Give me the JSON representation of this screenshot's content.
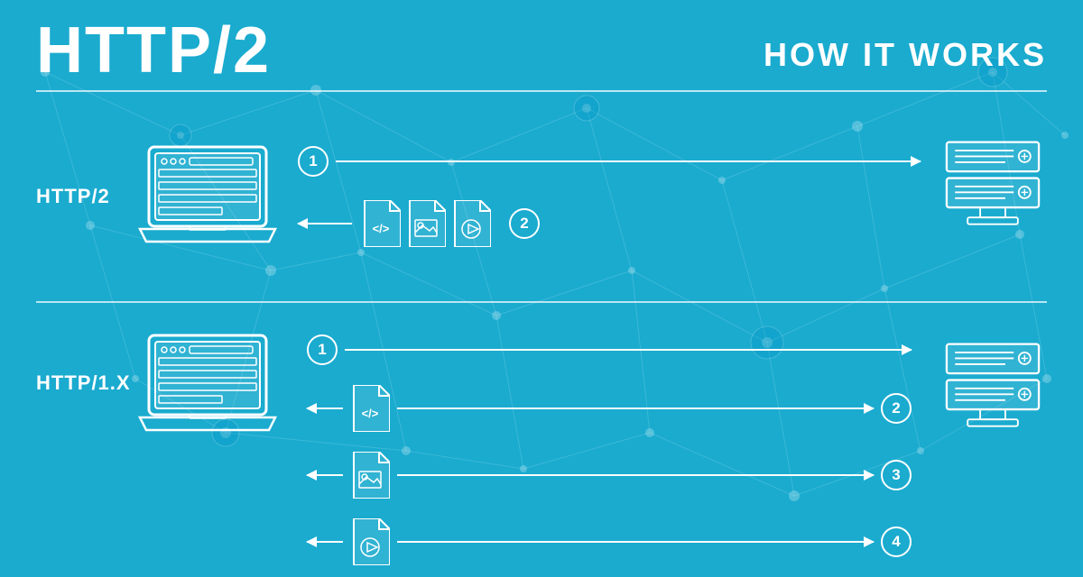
{
  "header": {
    "main_title": "HTTP/2",
    "subtitle": "HOW IT WORKS"
  },
  "http2": {
    "label": "HTTP/2",
    "step1": "1",
    "step2": "2",
    "files": [
      "code-file",
      "image-file",
      "video-file"
    ]
  },
  "http1": {
    "label": "HTTP/1.X",
    "step1": "1",
    "step2": "2",
    "step3": "3",
    "step4": "4",
    "files": [
      "code-file",
      "image-file",
      "video-file"
    ]
  },
  "colors": {
    "background": "#1aabcf",
    "text": "#ffffff",
    "accent": "#1590b5"
  }
}
